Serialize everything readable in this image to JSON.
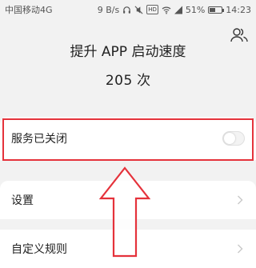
{
  "status_bar": {
    "carrier": "中国移动4G",
    "speed": "9 B/s",
    "battery": "51%",
    "battery_level": 0.51,
    "time": "14:23",
    "icons": [
      "headphone-icon",
      "mute-icon",
      "hd-badge",
      "wifi-icon",
      "signal-icon",
      "battery-icon"
    ],
    "hd_label": "HD"
  },
  "header": {
    "title": "提升 APP 启动速度",
    "count_value": "205",
    "count_unit": "次",
    "profile_icon": "users-icon"
  },
  "service": {
    "label": "服务已关闭",
    "toggle_on": false
  },
  "menu": {
    "settings_label": "设置",
    "custom_rules_label": "自定义规则"
  },
  "annotation": {
    "highlight_color": "#e5323b",
    "arrow_icon": "up-arrow-icon"
  }
}
